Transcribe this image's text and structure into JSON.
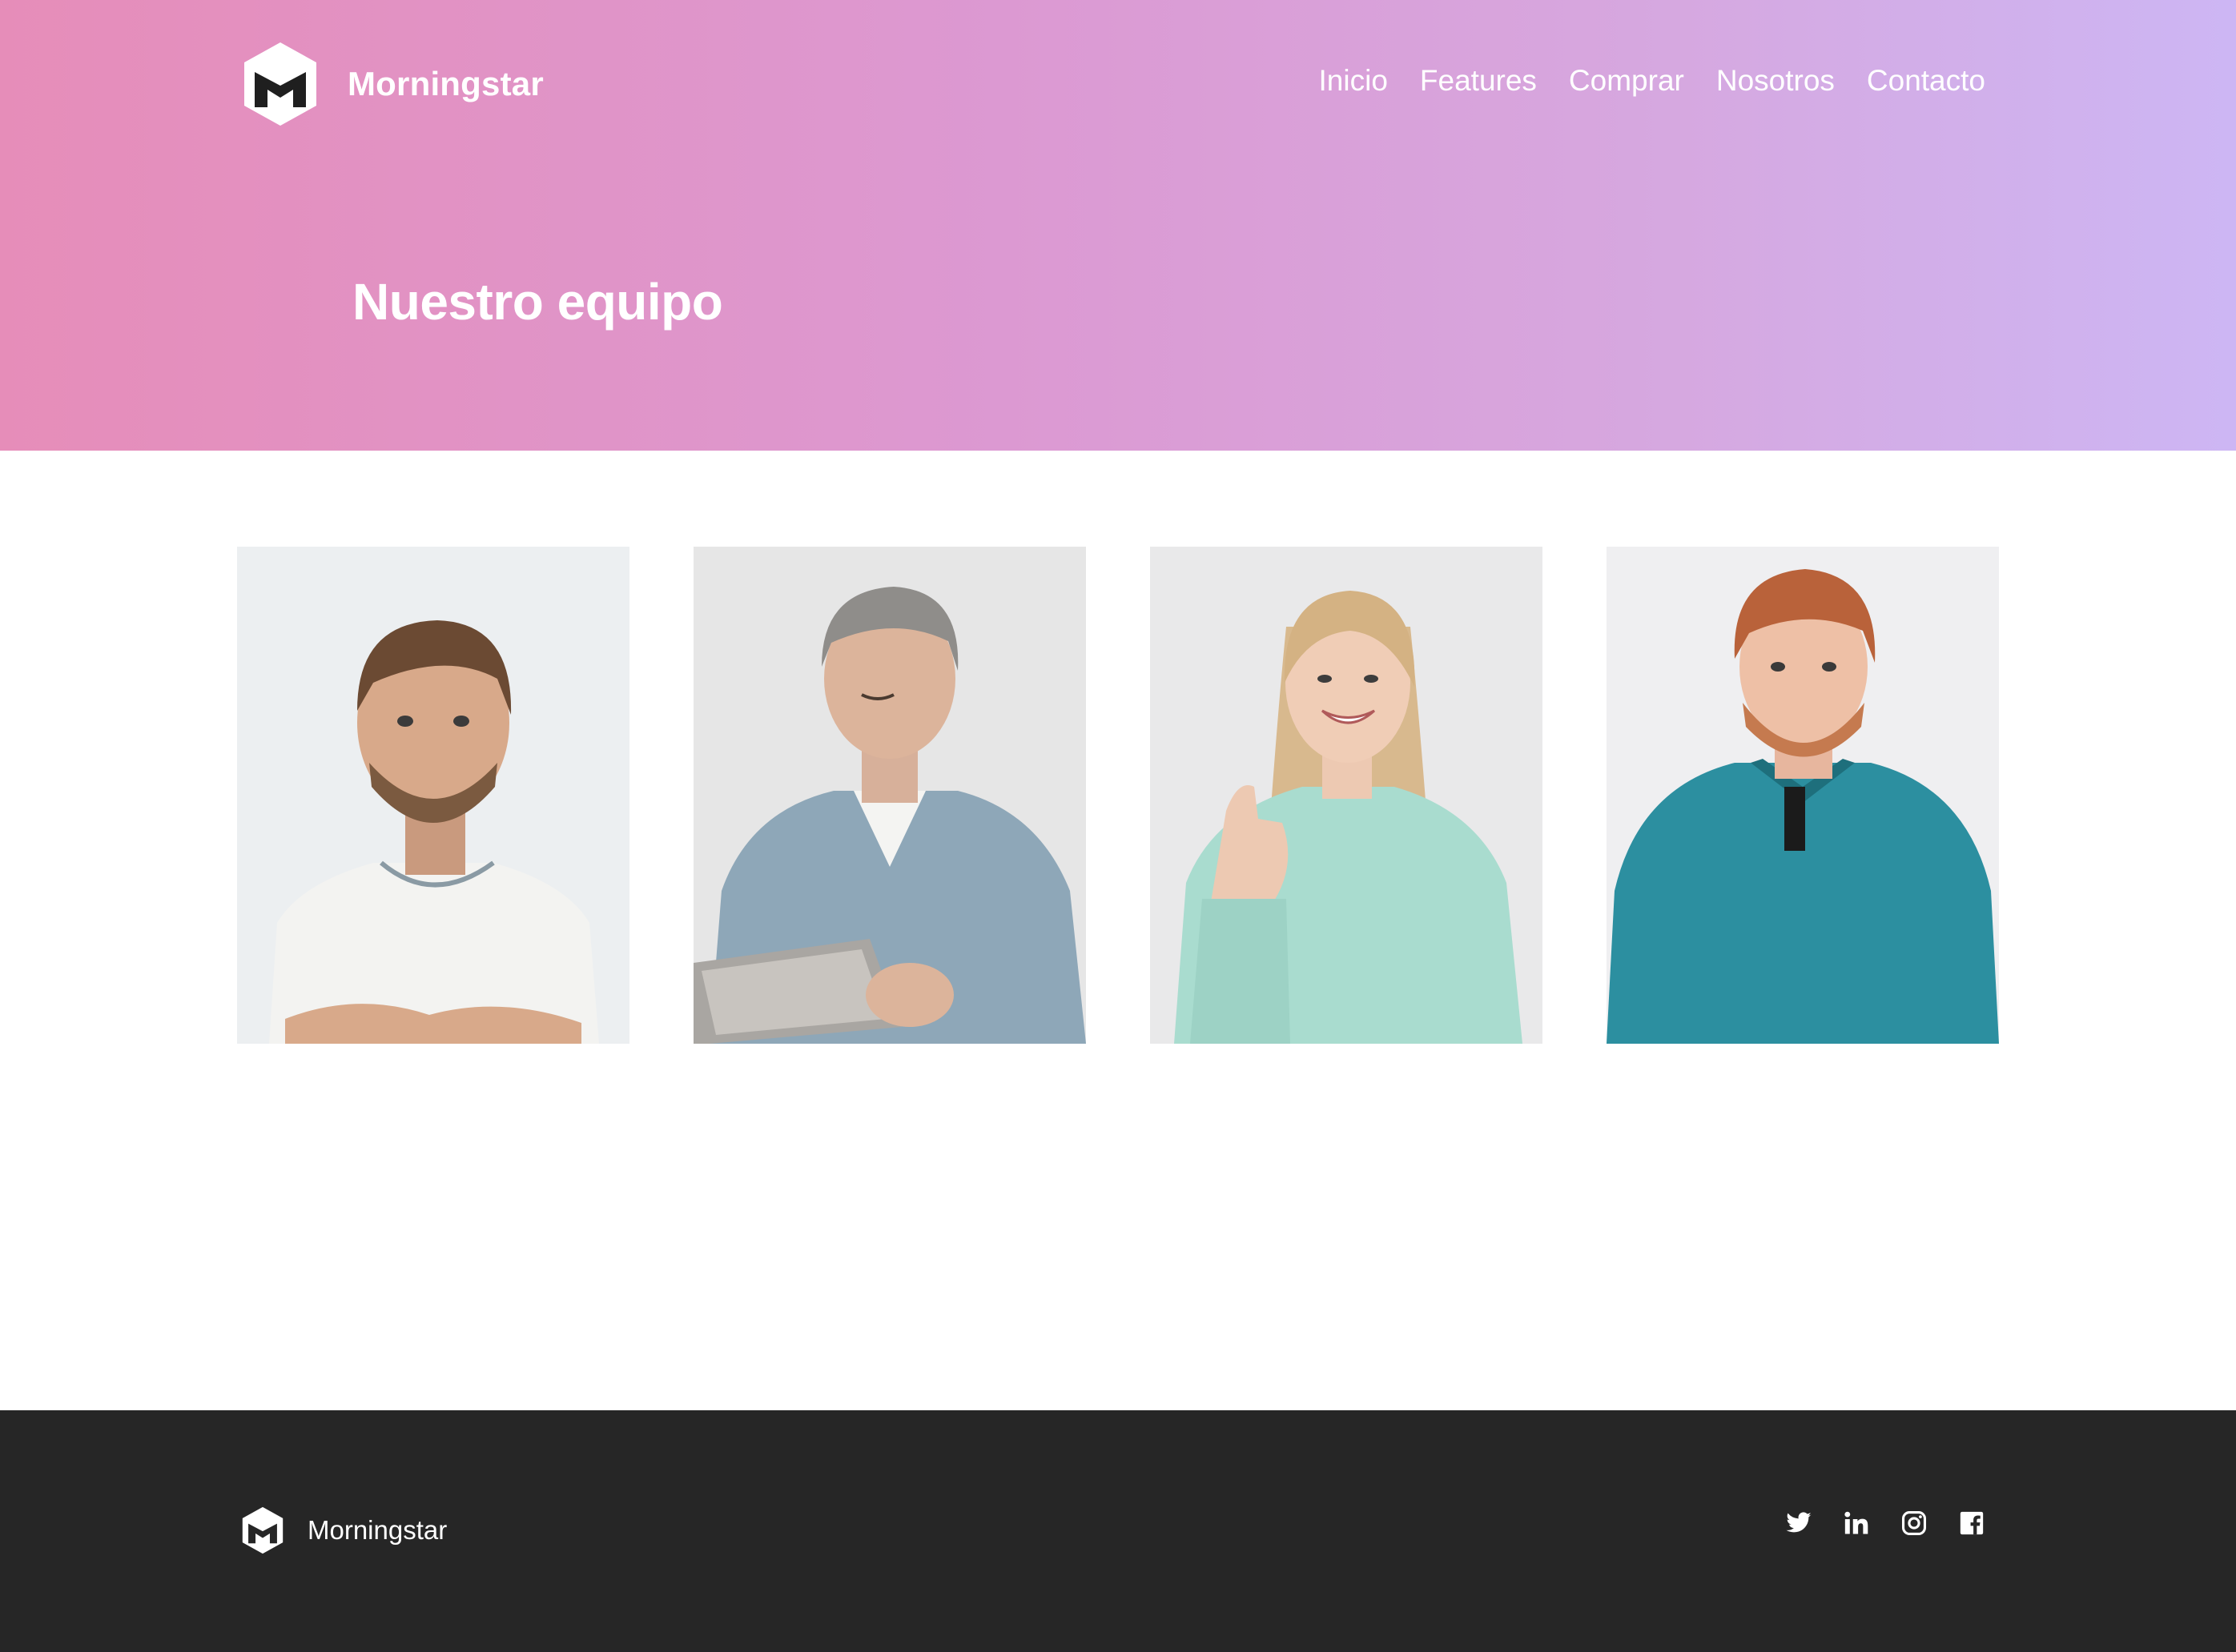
{
  "brand": {
    "name": "Morningstar",
    "logo_icon": "hexagon-m-logo-icon"
  },
  "nav": {
    "items": [
      {
        "label": "Inicio"
      },
      {
        "label": "Features"
      },
      {
        "label": "Comprar"
      },
      {
        "label": "Nosotros"
      },
      {
        "label": "Contacto"
      }
    ]
  },
  "hero": {
    "title": "Nuestro equipo",
    "gradient": [
      "#e68db9",
      "#cdb6f4"
    ]
  },
  "team": {
    "photos": [
      {
        "subject": "young man with short brown hair and beard, white t-shirt, arms crossed",
        "shirt_color": "#f1f1ef"
      },
      {
        "subject": "grey-haired man in denim shirt writing on a tablet",
        "shirt_color": "#8ea7b8"
      },
      {
        "subject": "smiling blonde woman in mint sweater giving thumbs up",
        "shirt_color": "#a9dccf"
      },
      {
        "subject": "red-haired bearded man in teal polo shirt",
        "shirt_color": "#2c8fa0"
      }
    ]
  },
  "footer": {
    "brand_name": "Morningstar",
    "background": "#262626",
    "social_icons": [
      "twitter-icon",
      "linkedin-icon",
      "instagram-icon",
      "facebook-icon"
    ]
  }
}
